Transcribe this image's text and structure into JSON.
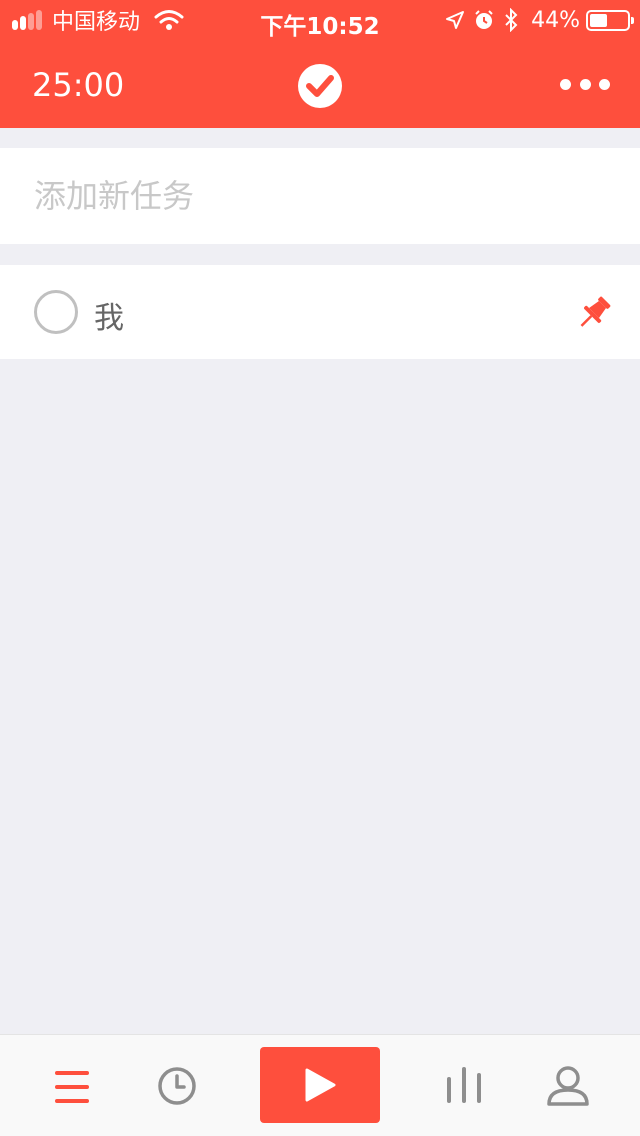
{
  "status_bar": {
    "carrier": "中国移动",
    "time": "下午10:52",
    "battery_percent": "44%",
    "battery_level": 0.44,
    "signal_bars_filled": 2,
    "signal_bars_total": 4,
    "icons": [
      "wifi-icon",
      "location-icon",
      "alarm-icon",
      "bluetooth-icon",
      "battery-icon"
    ]
  },
  "header": {
    "timer": "25:00",
    "logo_icon": "check-circle-icon",
    "menu_icon": "more-icon"
  },
  "add_task": {
    "placeholder": "添加新任务",
    "value": ""
  },
  "tasks": [
    {
      "label": "我",
      "checked": false,
      "pinned": true
    }
  ],
  "tabbar": {
    "items": [
      "list-icon",
      "clock-icon",
      "play-icon",
      "stats-icon",
      "profile-icon"
    ],
    "active": "list-icon"
  },
  "colors": {
    "accent": "#fe4f3d",
    "background": "#efeff4",
    "tab_inactive": "#8e8e8e"
  }
}
